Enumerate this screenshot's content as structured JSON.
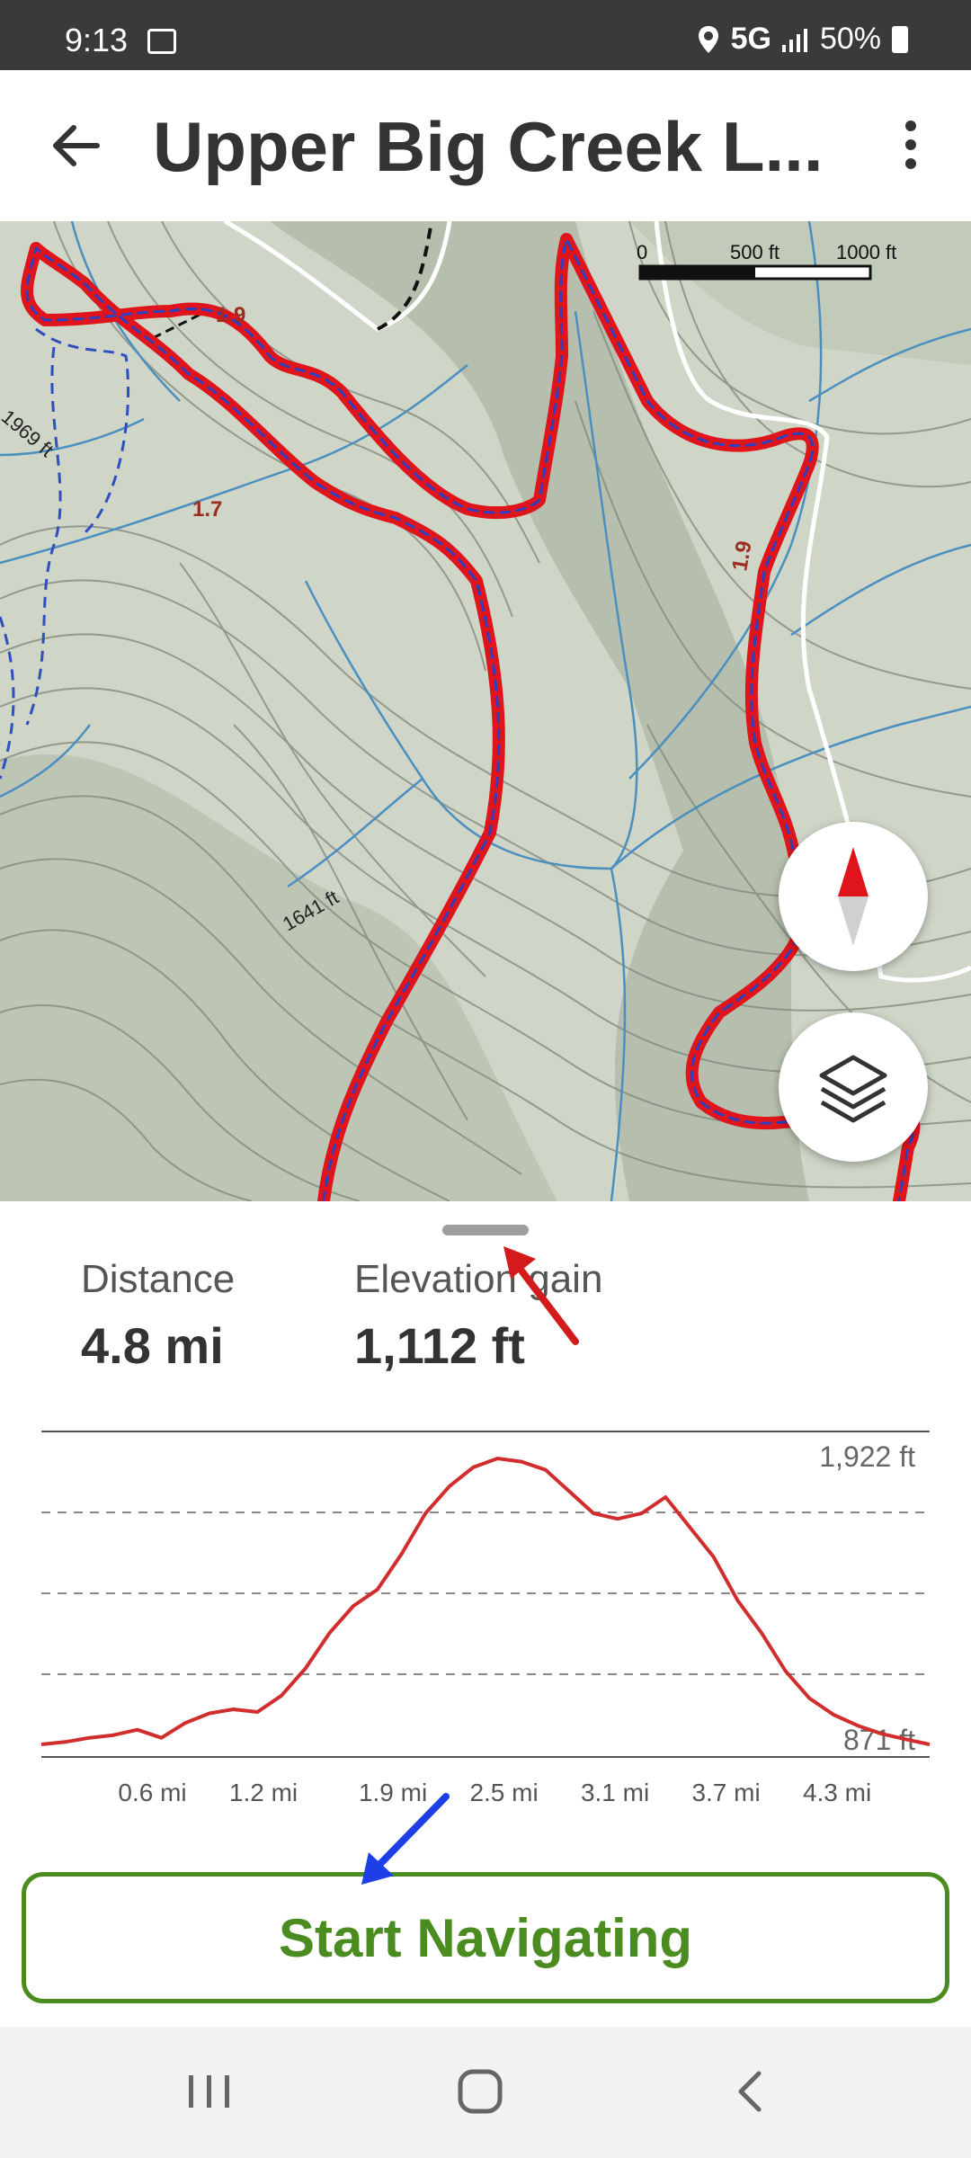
{
  "status_bar": {
    "time": "9:13",
    "network": "5G",
    "battery": "50%"
  },
  "app_bar": {
    "title": "Upper Big Creek L..."
  },
  "map": {
    "scale_labels": [
      "0",
      "500 ft",
      "1000 ft"
    ],
    "contour_labels": [
      "1969 ft",
      "1641 ft"
    ],
    "trail_markers": [
      "1.9",
      "1.7",
      "1.9"
    ]
  },
  "stats": {
    "distance": {
      "label": "Distance",
      "value": "4.8 mi"
    },
    "elevation_gain": {
      "label": "Elevation gain",
      "value": "1,112 ft"
    }
  },
  "chart_data": {
    "type": "line",
    "series": [
      {
        "values": [
          871,
          880,
          895,
          905,
          925,
          895,
          950,
          985,
          1000,
          990,
          1050,
          1150,
          1280,
          1380,
          1440,
          1570,
          1720,
          1820,
          1890,
          1922,
          1910,
          1880,
          1800,
          1720,
          1700,
          1720,
          1780,
          1670,
          1560,
          1400,
          1280,
          1140,
          1040,
          980,
          940,
          910,
          890,
          871
        ]
      }
    ],
    "x_tick_labels": [
      "0.6 mi",
      "1.2 mi",
      "1.9 mi",
      "2.5 mi",
      "3.1 mi",
      "3.7 mi",
      "4.3 mi"
    ],
    "y_labels": {
      "max": "1,922 ft",
      "min": "871 ft"
    },
    "ylim": [
      871,
      1922
    ],
    "xlim_mi": [
      0,
      4.8
    ],
    "grid": "dashed horizontal",
    "color": "#d12d2d"
  },
  "actions": {
    "start_navigating": "Start Navigating"
  },
  "colors": {
    "route": "#e0141b",
    "button_green": "#4a8c1f",
    "map_bg": "#cfd6c8"
  },
  "icons": {
    "back": "arrow-left-icon",
    "menu": "more-vertical-icon",
    "compass": "compass-icon",
    "layers": "layers-icon"
  }
}
